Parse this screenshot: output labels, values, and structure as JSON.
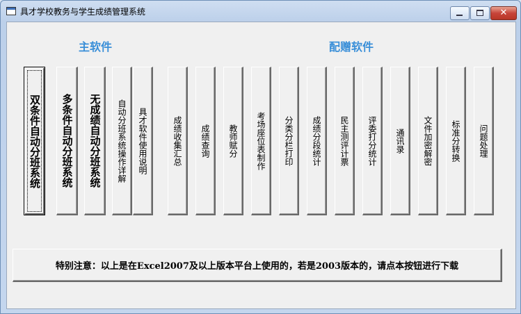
{
  "window": {
    "title": "具才学校教务与学生成绩管理系统",
    "controls": {
      "minimize": "minimize",
      "maximize": "maximize",
      "close": "✕"
    }
  },
  "sections": {
    "main": "主软件",
    "bonus": "配赠软件"
  },
  "buttons": [
    "双条件自动分班系统",
    "多条件自动分班系统",
    "无成绩自动分班系统",
    "自动分班系统操作详解",
    "具才软件使用说明",
    "成绩收集汇总",
    "成绩查询",
    "教师赋分",
    "考场座位表制作",
    "分类分栏打印",
    "成绩分段统计",
    "民主测评计票",
    "评委打分统计",
    "通讯录",
    "文件加密解密",
    "标准分转换",
    "问题处理"
  ],
  "notice": "特别注意：以上是在Excel2007及以上版本平台上使用的，若是2003版本的，请点本按钮进行下载"
}
